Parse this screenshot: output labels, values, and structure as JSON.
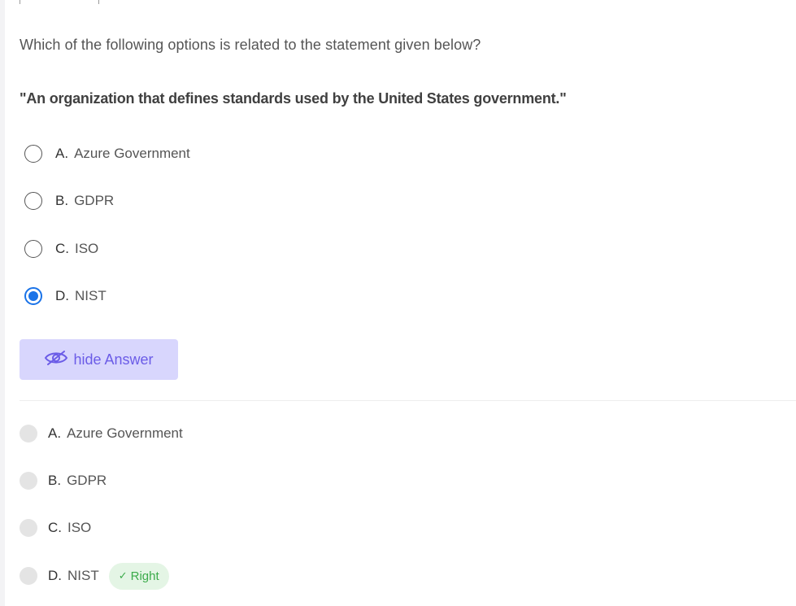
{
  "question": {
    "prompt": "Which of the following options is related to the statement given below?",
    "statement": "\"An organization that defines standards used by the United States government.\""
  },
  "options": [
    {
      "letter": "A.",
      "text": "Azure Government",
      "selected": false
    },
    {
      "letter": "B.",
      "text": "GDPR",
      "selected": false
    },
    {
      "letter": "C.",
      "text": "ISO",
      "selected": false
    },
    {
      "letter": "D.",
      "text": "NIST",
      "selected": true
    }
  ],
  "answer_toggle": {
    "label": "hide Answer",
    "icon": "eye-slash-icon"
  },
  "answers": [
    {
      "letter": "A.",
      "text": "Azure Government"
    },
    {
      "letter": "B.",
      "text": "GDPR"
    },
    {
      "letter": "C.",
      "text": "ISO"
    },
    {
      "letter": "D.",
      "text": "NIST",
      "badge": "Right"
    }
  ],
  "colors": {
    "selected_radio": "#1a73e8",
    "button_bg": "#d8d6fd",
    "button_text": "#6b5ce7",
    "badge_bg": "#e4f5e5",
    "badge_text": "#3bab4a"
  }
}
